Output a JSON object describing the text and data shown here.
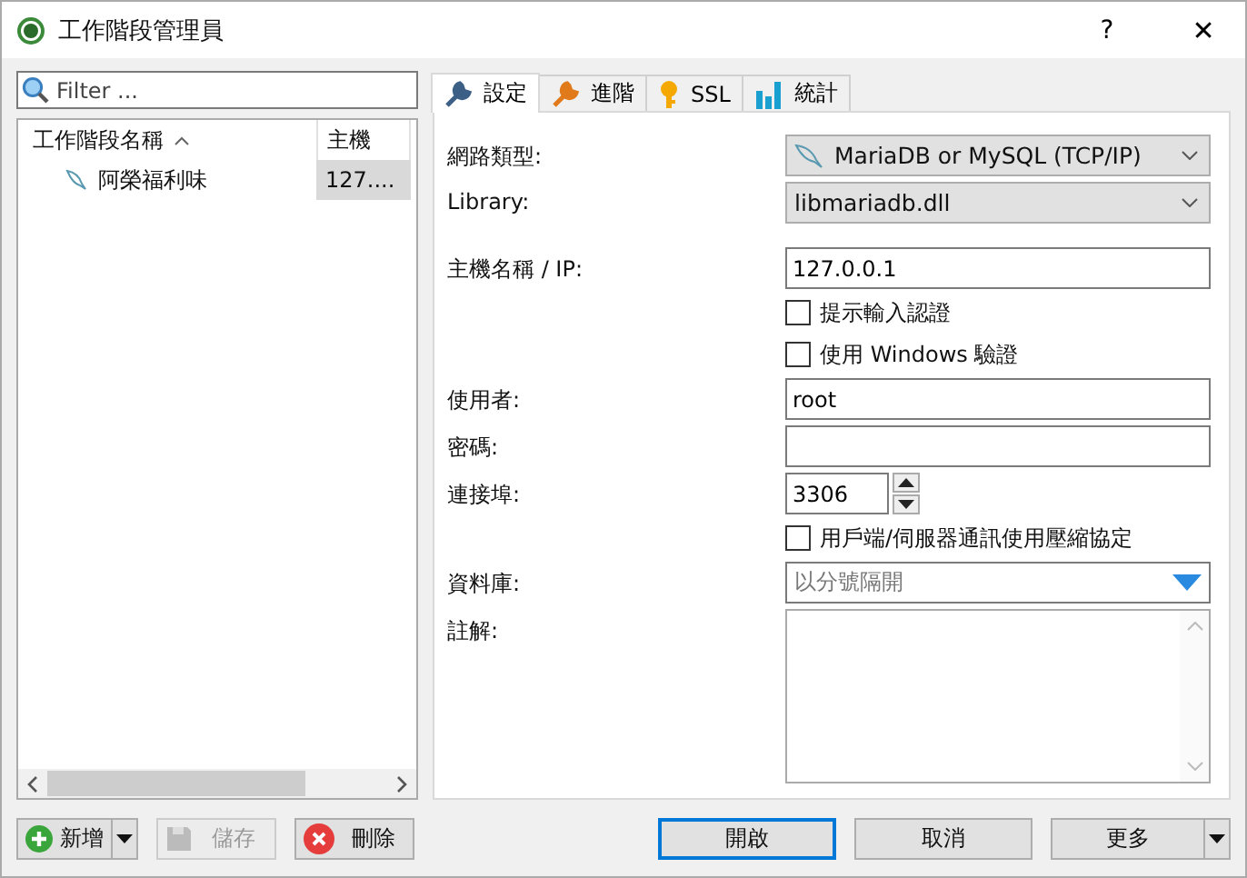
{
  "window": {
    "title": "工作階段管理員",
    "help": "?",
    "close": "✕"
  },
  "filter": {
    "placeholder": "Filter ..."
  },
  "sessions": {
    "columns": [
      "工作階段名稱",
      "主機"
    ],
    "rows": [
      {
        "name": "阿榮福利味",
        "host": "127....",
        "selected": true
      }
    ]
  },
  "tabs": [
    {
      "label": "設定",
      "selected": true
    },
    {
      "label": "進階",
      "selected": false
    },
    {
      "label": "SSL",
      "selected": false
    },
    {
      "label": "統計",
      "selected": false
    }
  ],
  "form": [
    {
      "kind": "select",
      "label": "網路類型:",
      "value": "MariaDB or MySQL (TCP/IP)"
    },
    {
      "kind": "select",
      "label": "Library:",
      "value": "libmariadb.dll"
    },
    {
      "kind": "input",
      "label": "主機名稱 / IP:",
      "value": "127.0.0.1"
    },
    {
      "kind": "checkbox",
      "text": "提示輸入認證",
      "checked": false
    },
    {
      "kind": "checkbox",
      "text": "使用 Windows 驗證",
      "checked": false
    },
    {
      "kind": "input",
      "label": "使用者:",
      "value": "root"
    },
    {
      "kind": "input",
      "label": "密碼:"
    },
    {
      "kind": "spinner",
      "label": "連接埠:",
      "value": "3306"
    },
    {
      "kind": "checkbox",
      "text": "用戶端/伺服器通訊使用壓縮協定",
      "checked": false
    },
    {
      "kind": "combo",
      "label": "資料庫:",
      "placeholder": "以分號隔開"
    },
    {
      "kind": "textarea",
      "label": "註解:"
    }
  ],
  "left_buttons": [
    {
      "label": "新增",
      "dropdown": true,
      "disabled": false
    },
    {
      "label": "儲存",
      "dropdown": false,
      "disabled": true
    },
    {
      "label": "刪除",
      "dropdown": false,
      "disabled": false
    }
  ],
  "right_buttons": [
    {
      "label": "開啟",
      "default": true,
      "dropdown": false
    },
    {
      "label": "取消",
      "default": false,
      "dropdown": false
    },
    {
      "label": "更多",
      "default": false,
      "dropdown": true
    }
  ]
}
